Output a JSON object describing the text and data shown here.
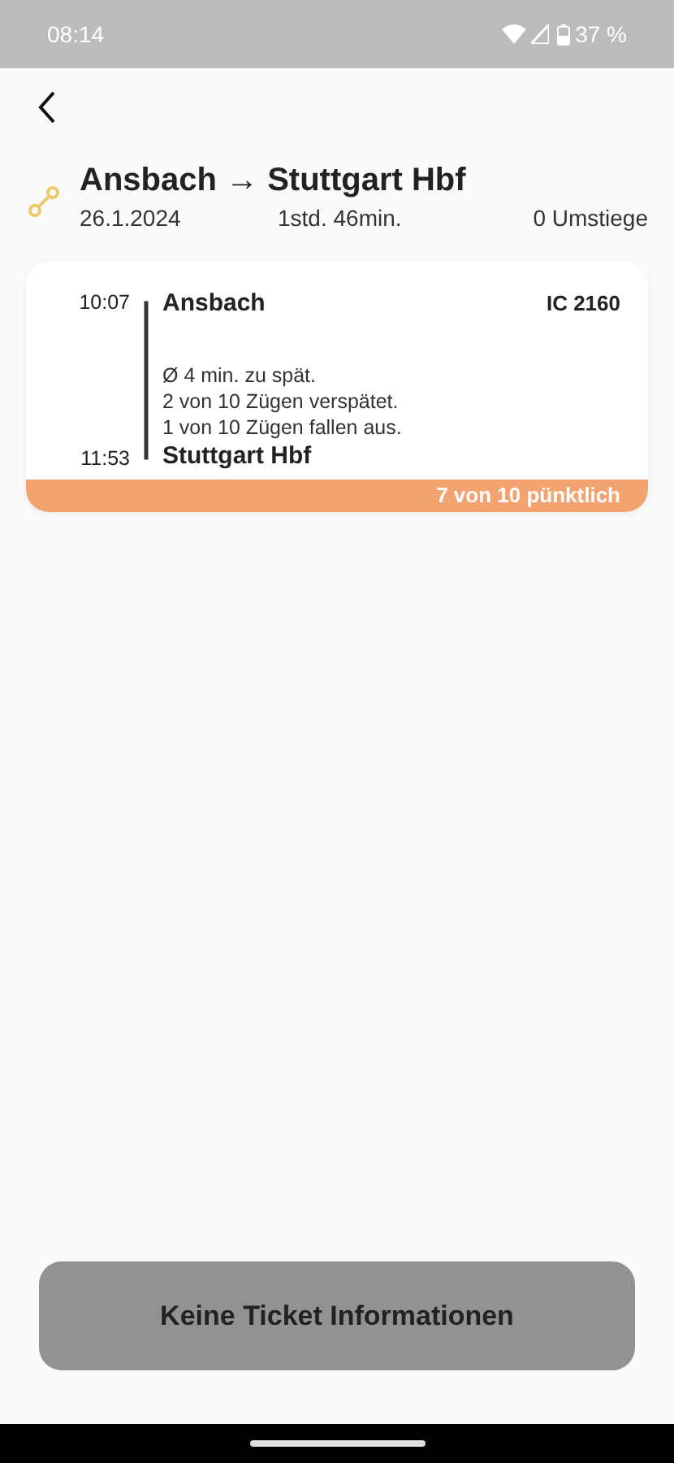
{
  "status_bar": {
    "time": "08:14",
    "battery": "37 %"
  },
  "header": {
    "title": "Ansbach → Stuttgart Hbf",
    "date": "26.1.2024",
    "duration": "1std. 46min.",
    "transfers": "0 Umstiege"
  },
  "connection": {
    "train": "IC 2160",
    "stops": [
      {
        "time": "10:07",
        "station": "Ansbach"
      },
      {
        "time": "11:53",
        "station": "Stuttgart Hbf"
      }
    ],
    "stats": [
      "Ø 4 min. zu spät.",
      "2 von 10 Zügen verspätet.",
      "1 von 10 Zügen fallen aus."
    ],
    "punctuality": "7 von 10 pünktlich"
  },
  "ticket_button": {
    "label": "Keine Ticket Informationen",
    "disabled": true
  }
}
